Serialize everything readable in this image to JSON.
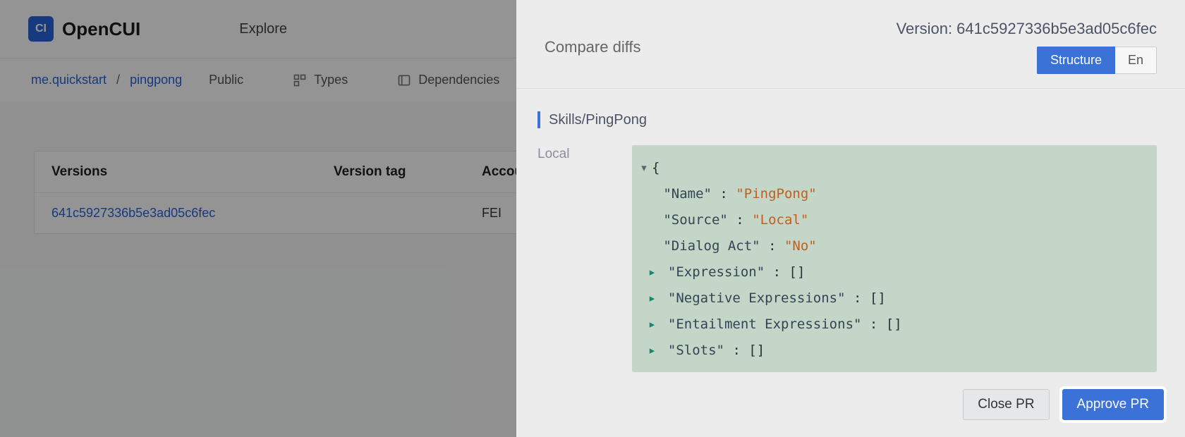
{
  "brand": {
    "badge": "CI",
    "name": "OpenCUI"
  },
  "nav": {
    "explore": "Explore"
  },
  "breadcrumb": {
    "org": "me.quickstart",
    "sep": "/",
    "project": "pingpong",
    "visibility": "Public"
  },
  "tabs": {
    "types": "Types",
    "dependencies": "Dependencies"
  },
  "versions_table": {
    "columns": {
      "versions": "Versions",
      "tag": "Version tag",
      "account": "Accoun"
    },
    "rows": [
      {
        "version": "641c5927336b5e3ad05c6fec",
        "tag": "",
        "account": "FEI"
      }
    ]
  },
  "panel": {
    "title": "Compare diffs",
    "version_label": "Version: 641c5927336b5e3ad05c6fec",
    "seg": {
      "structure": "Structure",
      "en": "En"
    },
    "path": "Skills/PingPong",
    "side_label": "Local",
    "code": {
      "open": "{",
      "entries": [
        {
          "key": "\"Name\"",
          "val": "\"PingPong\"",
          "type": "kv",
          "caret": ""
        },
        {
          "key": "\"Source\"",
          "val": "\"Local\"",
          "type": "kv",
          "caret": ""
        },
        {
          "key": "\"Dialog Act\"",
          "val": "\"No\"",
          "type": "kv",
          "caret": ""
        },
        {
          "key": "\"Expression\"",
          "val": "[]",
          "type": "arr",
          "caret": "▸"
        },
        {
          "key": "\"Negative Expressions\"",
          "val": "[]",
          "type": "arr",
          "caret": "▸"
        },
        {
          "key": "\"Entailment Expressions\"",
          "val": "[]",
          "type": "arr",
          "caret": "▸"
        },
        {
          "key": "\"Slots\"",
          "val": "[]",
          "type": "arr",
          "caret": "▸"
        }
      ]
    },
    "buttons": {
      "close": "Close PR",
      "approve": "Approve PR"
    }
  }
}
